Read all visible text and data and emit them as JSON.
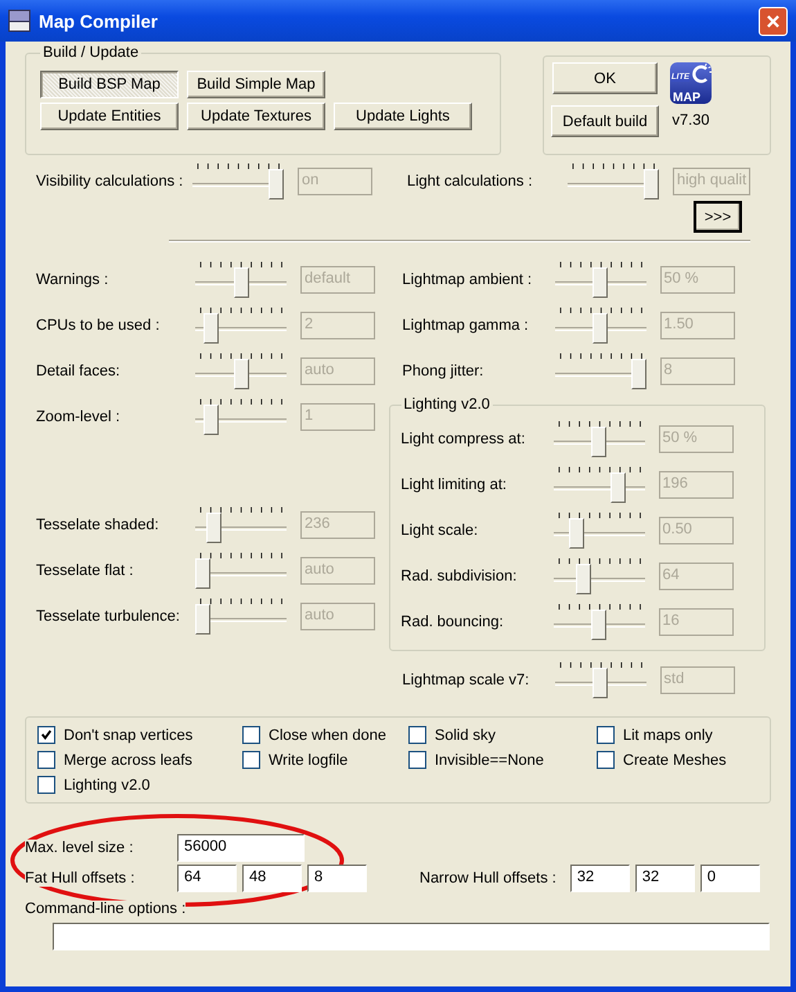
{
  "window": {
    "title": "Map Compiler"
  },
  "build_update": {
    "title": "Build / Update",
    "buttons": [
      {
        "label": "Build BSP Map",
        "pressed": true
      },
      {
        "label": "Build Simple Map",
        "pressed": false
      },
      {
        "label": "Update Entities",
        "pressed": false
      },
      {
        "label": "Update Textures",
        "pressed": false
      },
      {
        "label": "Update Lights",
        "pressed": false
      }
    ]
  },
  "actions": {
    "buttons": [
      {
        "label": "OK"
      },
      {
        "label": "Default build"
      }
    ],
    "logo": {
      "top": "LITE",
      "bottom": "MAP"
    },
    "version": "v7.30"
  },
  "calculations": [
    {
      "label": "Visibility calculations :",
      "level": 1,
      "reading": "on"
    },
    {
      "label": "Light calculations :",
      "level": 1,
      "reading": "high qualit"
    }
  ],
  "expand_button": {
    "label": ">>>",
    "focused": true
  },
  "left_settings": [
    {
      "label": "Warnings :",
      "level": 0.5,
      "reading": "default"
    },
    {
      "label": "CPUs to be used :",
      "level": 0.1,
      "reading": "2"
    },
    {
      "label": "Detail faces:",
      "level": 0.5,
      "reading": "auto"
    },
    {
      "label": "Zoom-level :",
      "level": 0.1,
      "reading": "1"
    }
  ],
  "tessellation": [
    {
      "label": "Tesselate shaded:",
      "level": 0.15,
      "reading": "236"
    },
    {
      "label": "Tesselate flat :",
      "level": 0,
      "reading": "auto"
    },
    {
      "label": "Tesselate turbulence:",
      "level": 0,
      "reading": "auto"
    }
  ],
  "right_settings": [
    {
      "label": "Lightmap ambient :",
      "level": 0.5,
      "reading": "50 %"
    },
    {
      "label": "Lightmap gamma :",
      "level": 0.5,
      "reading": "1.50"
    },
    {
      "label": "Phong jitter:",
      "level": 1,
      "reading": "8"
    }
  ],
  "lighting_v2": {
    "title": "Lighting v2.0",
    "settings": [
      {
        "label": "Light compress at:",
        "level": 0.5,
        "reading": "50 %"
      },
      {
        "label": "Light limiting at:",
        "level": 0.75,
        "reading": "196"
      },
      {
        "label": "Light scale:",
        "level": 0.2,
        "reading": "0.50"
      },
      {
        "label": "Rad. subdivision:",
        "level": 0.3,
        "reading": "64"
      },
      {
        "label": "Rad. bouncing:",
        "level": 0.5,
        "reading": "16"
      }
    ]
  },
  "lightmap_scale": {
    "label": "Lightmap scale v7:",
    "level": 0.5,
    "reading": "std"
  },
  "options": [
    {
      "label": "Don't snap vertices",
      "checked": true
    },
    {
      "label": "Close when done",
      "checked": false
    },
    {
      "label": "Solid sky",
      "checked": false
    },
    {
      "label": "Lit maps only",
      "checked": false
    },
    {
      "label": "Merge across leafs",
      "checked": false
    },
    {
      "label": "Write logfile",
      "checked": false
    },
    {
      "label": "Invisible==None",
      "checked": false
    },
    {
      "label": "Create Meshes",
      "checked": false
    },
    {
      "label": "Lighting v2.0",
      "checked": false
    }
  ],
  "max_level_size": {
    "label": "Max. level size :",
    "value": "56000"
  },
  "fat_hull": {
    "label": "Fat Hull offsets :",
    "values": [
      "64",
      "48",
      "8"
    ]
  },
  "narrow_hull": {
    "label": "Narrow Hull offsets :",
    "values": [
      "32",
      "32",
      "0"
    ]
  },
  "command_line": {
    "label": "Command-line options :"
  },
  "annotation": {
    "kind": "ellipse"
  }
}
